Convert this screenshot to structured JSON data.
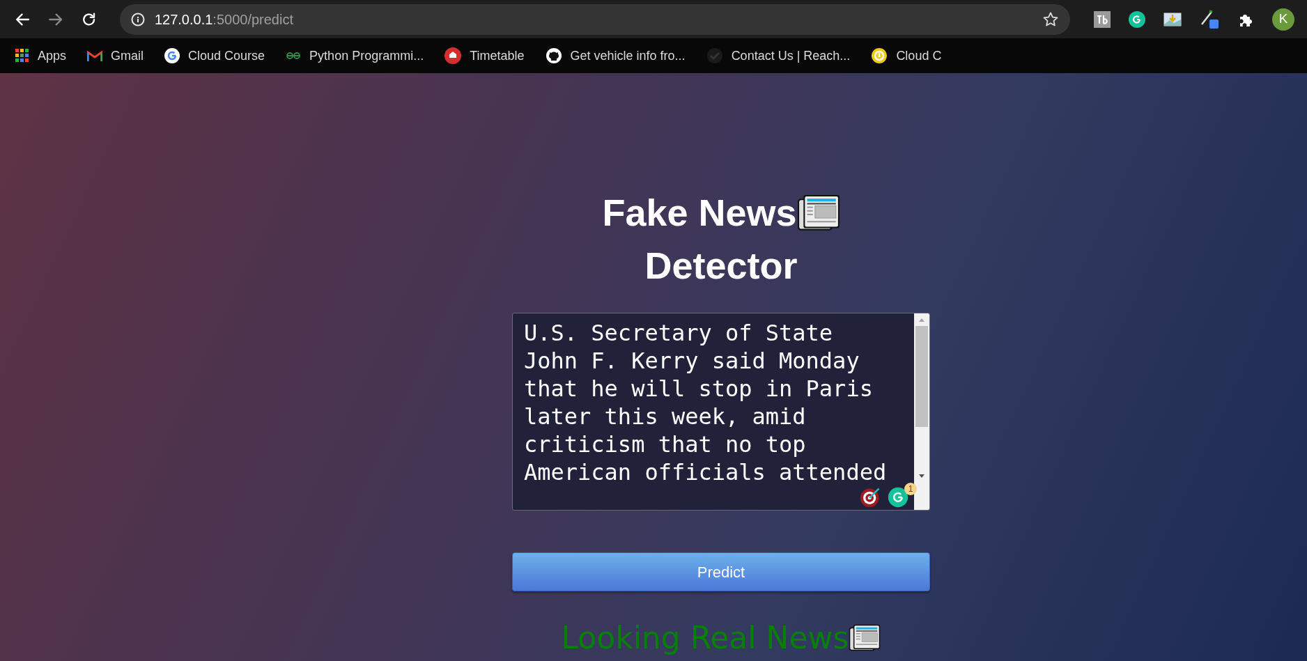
{
  "browser": {
    "nav": [
      {
        "kind": "back",
        "disabled": false
      },
      {
        "kind": "forward",
        "disabled": true
      },
      {
        "kind": "reload",
        "disabled": false
      }
    ],
    "address": {
      "host": "127.0.0.1",
      "path": ":5000/predict"
    },
    "bookmarks": [
      "Apps",
      "Gmail",
      "Cloud Course",
      "Python Programmi...",
      "Timetable",
      "Get vehicle info fro...",
      "Contact Us | Reach...",
      "Cloud C"
    ],
    "profile": "K"
  },
  "page": {
    "title_lines": [
      "Fake News",
      "Detector"
    ],
    "article": "U.S. Secretary of State John F. Kerry said Monday that he will stop in Paris later this week, amid criticism that no top American officials attended",
    "grammarly_count": "1",
    "button": "Predict",
    "result": "Looking Real News"
  }
}
